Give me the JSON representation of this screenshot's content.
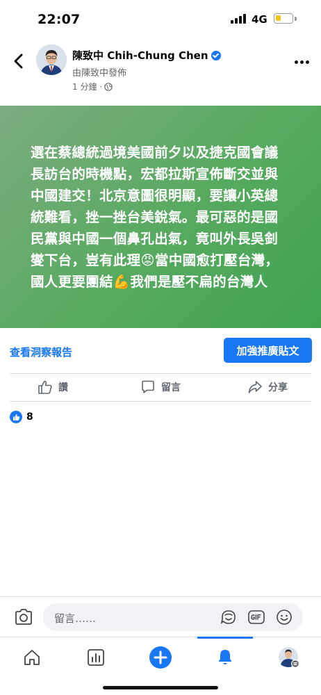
{
  "status_bar": {
    "time": "22:07",
    "network": "4G",
    "battery_level": 0.35,
    "battery_color": "#f3c318"
  },
  "post": {
    "author": "陳致中 Chih-Chung Chen",
    "verified": true,
    "published_by": "由陳致中發佈",
    "time_ago": "1 分鐘 ·",
    "privacy_icon": "globe-icon",
    "text": "選在蔡總統過境美國前夕以及捷克國會議長訪台的時機點，宏都拉斯宣佈斷交並與中國建交！北京意圖很明顯，要讓小英總統難看，挫一挫台美銳氣。最可惡的是國民黨與中國一個鼻孔出氣，竟叫外長吳釗燮下台，豈有此理😡當中國愈打壓台灣，國人更要團結💪我們是壓不扁的台灣人",
    "banner_colors": [
      "#7cac7f",
      "#3fa350"
    ]
  },
  "insights": {
    "link_label": "查看洞察報告",
    "boost_label": "加強推廣貼文"
  },
  "actions": {
    "like": "讚",
    "comment": "留言",
    "share": "分享"
  },
  "reactions": {
    "count": "8"
  },
  "composer": {
    "placeholder": "留言……"
  },
  "nav": {
    "items": [
      "home-icon",
      "dashboard-icon",
      "create-icon",
      "notifications-icon",
      "profile-menu-icon"
    ],
    "active": "notifications-icon",
    "accent": "#1877f2"
  }
}
